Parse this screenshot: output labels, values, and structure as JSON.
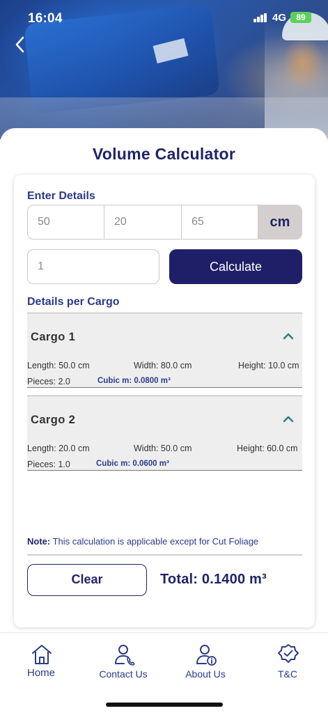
{
  "status_bar": {
    "time": "16:04",
    "network": "4G",
    "battery": "89"
  },
  "header": {
    "title": "Volume Calculator"
  },
  "form": {
    "section_label": "Enter Details",
    "dim1_placeholder": "50",
    "dim2_placeholder": "20",
    "dim3_placeholder": "65",
    "unit": "cm",
    "pieces_placeholder": "1",
    "calculate_label": "Calculate"
  },
  "details": {
    "section_label": "Details per Cargo",
    "cargos": [
      {
        "name": "Cargo 1",
        "length": "Length: 50.0 cm",
        "width": "Width: 80.0 cm",
        "height": "Height: 10.0 cm",
        "pieces": "Pieces: 2.0",
        "cubic": "Cubic m: 0.0800 m³"
      },
      {
        "name": "Cargo 2",
        "length": "Length: 20.0 cm",
        "width": "Width: 50.0 cm",
        "height": "Height: 60.0 cm",
        "pieces": "Pieces: 1.0",
        "cubic": "Cubic m: 0.0600 m³"
      }
    ]
  },
  "note": {
    "label": "Note:",
    "text": "This calculation is applicable except for Cut Foliage"
  },
  "footer": {
    "clear_label": "Clear",
    "total": "Total: 0.1400 m³"
  },
  "tabbar": {
    "items": [
      {
        "label": "Home",
        "icon": "home-icon"
      },
      {
        "label": "Contact Us",
        "icon": "contact-person-icon"
      },
      {
        "label": "About Us",
        "icon": "about-person-info-icon"
      },
      {
        "label": "T&C",
        "icon": "badge-check-icon"
      }
    ]
  },
  "colors": {
    "primary": "#1f1f68",
    "accent_text": "#2b3a8a",
    "unit_bg": "#d5cece",
    "cargo_bg": "#eeeeee",
    "chevron": "#2c7a7a"
  }
}
